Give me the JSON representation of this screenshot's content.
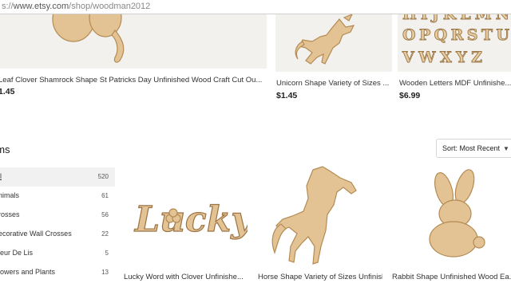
{
  "browser": {
    "url_prefix": "s://",
    "url_host": "www.etsy.com",
    "url_path": "/shop/woodman2012"
  },
  "top_listings": [
    {
      "title": "Leaf Clover Shamrock Shape St Patricks Day Unfinished Wood Craft Cut Ou...",
      "price": "1.45"
    },
    {
      "title": "Unicorn Shape Variety of Sizes ...",
      "price": "$1.45"
    },
    {
      "title": "Wooden Letters MDF Unfinishe...",
      "price": "$6.99"
    }
  ],
  "letters_image": {
    "rows": [
      "HIJKLMN",
      "OPQRSTU",
      "VWXYZ"
    ]
  },
  "items_section": {
    "heading": "ems",
    "sort_label": "Sort: Most Recent"
  },
  "categories": [
    {
      "label": "ll",
      "count": "520"
    },
    {
      "label": "nimals",
      "count": "61"
    },
    {
      "label": "rosses",
      "count": "56"
    },
    {
      "label": "ecorative Wall Crosses",
      "count": "22"
    },
    {
      "label": "leur De Lis",
      "count": "5"
    },
    {
      "label": "lowers and Plants",
      "count": "13"
    }
  ],
  "bottom_listings": [
    {
      "title": "Lucky Word with Clover Unfinishe...",
      "image_text": "Lucky"
    },
    {
      "title": "Horse Shape Variety of Sizes Unfinish..."
    },
    {
      "title": "Rabbit Shape Unfinished Wood Ea..."
    }
  ],
  "colors": {
    "wood": "#e3c294",
    "thumb_bg": "#f3f1ed"
  }
}
